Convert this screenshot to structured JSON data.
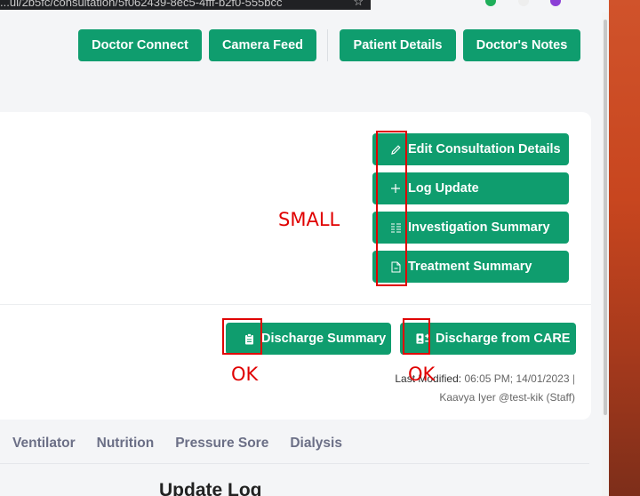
{
  "browser": {
    "url_fragment": "...ul/2b5fc/consultation/5f062439-8ec5-4fff-b2f0-555bcc"
  },
  "header_buttons": [
    "Doctor Connect",
    "Camera Feed",
    "Patient Details",
    "Doctor's Notes"
  ],
  "actions": {
    "edit_consultation": "Edit Consultation Details",
    "log_update": "Log Update",
    "investigation_summary": "Investigation Summary",
    "treatment_summary": "Treatment Summary",
    "discharge_summary": "Discharge Summary",
    "discharge_from_care": "Discharge from CARE"
  },
  "last_modified": {
    "label": "Last Modified:",
    "value": "06:05 PM; 14/01/2023",
    "separator": "|",
    "author": "Kaavya Iyer @test-kik (Staff)"
  },
  "tabs": [
    "Ventilator",
    "Nutrition",
    "Pressure Sore",
    "Dialysis"
  ],
  "section_heading": "Update Log",
  "annotations": {
    "small": "SMALL",
    "ok_1": "OK",
    "ok_2": "OK"
  },
  "colors": {
    "primary": "#0f9d6e",
    "annotation": "#e00000"
  },
  "icons": [
    "pencil-icon",
    "plus-icon",
    "list-icon",
    "file-icon",
    "clipboard-icon",
    "user-remove-icon",
    "star-icon"
  ]
}
